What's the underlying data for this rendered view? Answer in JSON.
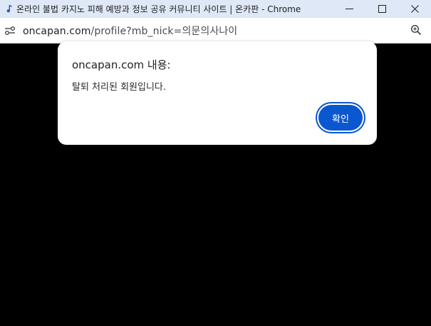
{
  "window": {
    "title": "온라인 불법 카지노 피해 예방과 정보 공유 커뮤니티 사이트 | 온카판 - Chrome",
    "icons": {
      "app": "music-note-icon",
      "minimize": "minimize-icon",
      "maximize": "maximize-icon",
      "close": "close-icon"
    }
  },
  "addressbar": {
    "url_host": "oncapan.com",
    "url_path": "/profile?mb_nick=의문의사나이",
    "icons": {
      "site_info": "site-info-icon",
      "zoom": "zoom-icon"
    }
  },
  "dialog": {
    "title": "oncapan.com 내용:",
    "message": "탈퇴 처리된 회원입니다.",
    "ok_label": "확인",
    "accent_color": "#0b57d0"
  }
}
